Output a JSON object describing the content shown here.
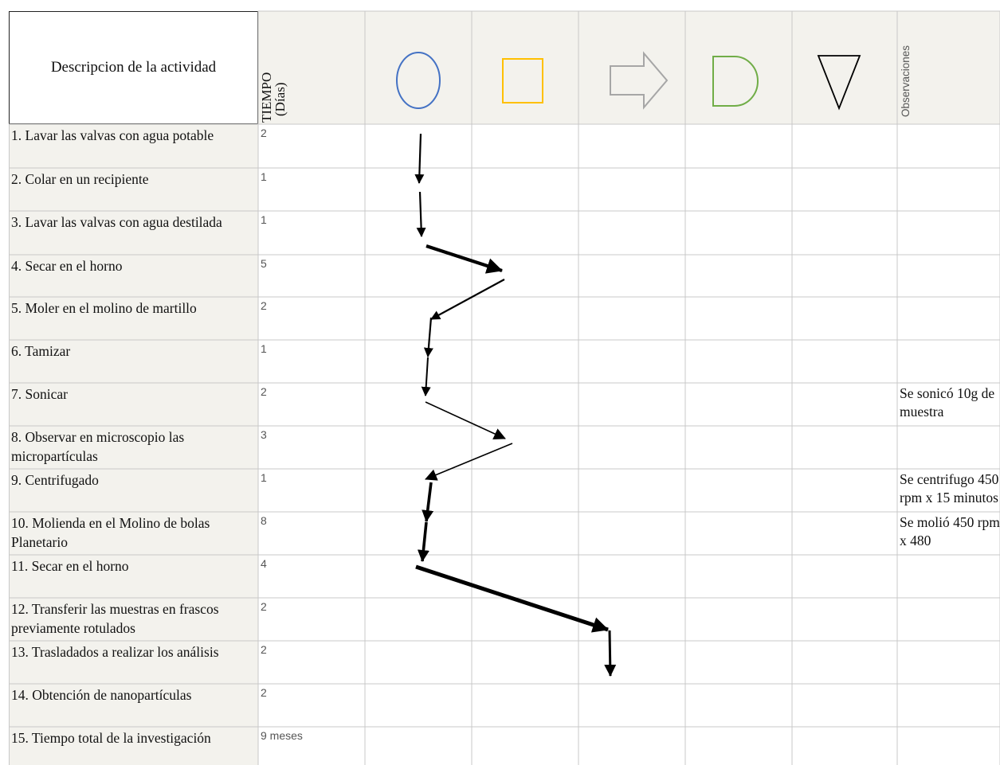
{
  "header": {
    "description_label": "Descripcion de la actividad",
    "time_label_line1": "TIEMPO",
    "time_label_line2": "(Días)",
    "observations_label": "Observaciones",
    "symbols": [
      {
        "name": "operation-circle-icon",
        "color": "#4472c4"
      },
      {
        "name": "inspection-square-icon",
        "color": "#ffc000"
      },
      {
        "name": "transport-arrow-icon",
        "color": "#a6a6a6"
      },
      {
        "name": "delay-d-shape-icon",
        "color": "#70ad47"
      },
      {
        "name": "storage-triangle-icon",
        "color": "#000000"
      }
    ]
  },
  "activities": [
    {
      "description": "1. Lavar las valvas con agua potable",
      "time": "2",
      "observation": ""
    },
    {
      "description": "2. Colar en un recipiente",
      "time": "1",
      "observation": ""
    },
    {
      "description": "3. Lavar las valvas con agua destilada",
      "time": "1",
      "observation": ""
    },
    {
      "description": "4. Secar en el horno",
      "time": "5",
      "observation": ""
    },
    {
      "description": "5. Moler en el molino de martillo",
      "time": "2",
      "observation": ""
    },
    {
      "description": "6. Tamizar",
      "time": "1",
      "observation": ""
    },
    {
      "description": "7. Sonicar",
      "time": "2",
      "observation": "Se sonicó 10g de muestra"
    },
    {
      "description": "8. Observar en microscopio las micropartículas",
      "time": "3",
      "observation": ""
    },
    {
      "description": "9. Centrifugado",
      "time": "1",
      "observation": "Se centrifugo 450 rpm x 15 minutos"
    },
    {
      "description": "10. Molienda en el Molino de bolas Planetario",
      "time": "8",
      "observation": "Se molió 450 rpm x 480"
    },
    {
      "description": "11. Secar en el horno",
      "time": "4",
      "observation": ""
    },
    {
      "description": "12. Transferir las muestras en frascos previamente rotulados",
      "time": "2",
      "observation": ""
    },
    {
      "description": "13. Trasladados a realizar los análisis",
      "time": "2",
      "observation": ""
    },
    {
      "description": "14. Obtención de nanopartículas",
      "time": "2",
      "observation": ""
    },
    {
      "description": "15. Tiempo total de la investigación",
      "time": "9 meses",
      "observation": ""
    }
  ],
  "flow_path": {
    "symbol_sequence": [
      "operation",
      "operation",
      "operation",
      "inspection",
      "operation",
      "operation",
      "operation",
      "inspection",
      "operation",
      "operation",
      "operation",
      "transport",
      "transport"
    ]
  },
  "colors": {
    "header_bg": "#f3f2ed",
    "cell_bg": "#f3f2ed",
    "grid_line": "#c8c8c8",
    "arrow": "#000000"
  }
}
